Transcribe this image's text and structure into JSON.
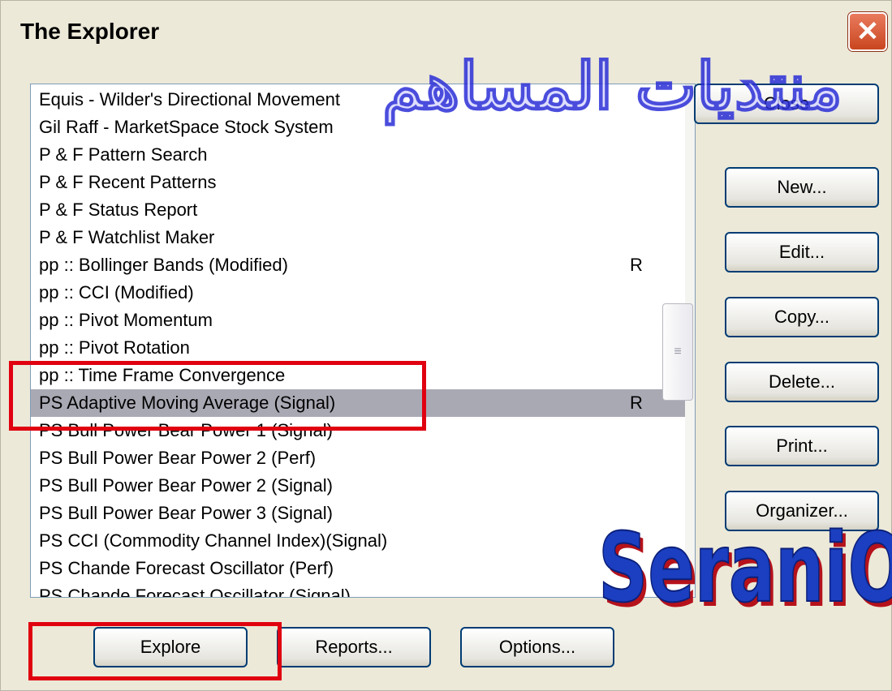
{
  "window": {
    "title": "The Explorer",
    "close_glyph": "✕"
  },
  "explorations": [
    {
      "name": "Equis - Wilder's Directional Movement",
      "flag": ""
    },
    {
      "name": "Gil Raff - MarketSpace Stock System",
      "flag": ""
    },
    {
      "name": "P & F Pattern Search",
      "flag": ""
    },
    {
      "name": "P & F Recent Patterns",
      "flag": ""
    },
    {
      "name": "P & F Status Report",
      "flag": ""
    },
    {
      "name": "P & F Watchlist Maker",
      "flag": ""
    },
    {
      "name": "pp :: Bollinger Bands (Modified)",
      "flag": "R"
    },
    {
      "name": "pp :: CCI (Modified)",
      "flag": ""
    },
    {
      "name": "pp :: Pivot Momentum",
      "flag": ""
    },
    {
      "name": "pp :: Pivot Rotation",
      "flag": ""
    },
    {
      "name": "pp :: Time Frame Convergence",
      "flag": ""
    },
    {
      "name": "PS Adaptive Moving Average (Signal)",
      "flag": "R",
      "selected": true
    },
    {
      "name": "PS Bull Power Bear Power 1 (Signal)",
      "flag": ""
    },
    {
      "name": "PS Bull Power Bear Power 2 (Perf)",
      "flag": ""
    },
    {
      "name": "PS Bull Power Bear Power 2 (Signal)",
      "flag": ""
    },
    {
      "name": "PS Bull Power Bear Power 3 (Signal)",
      "flag": ""
    },
    {
      "name": "PS CCI (Commodity Channel Index)(Signal)",
      "flag": ""
    },
    {
      "name": "PS Chande Forecast Oscillator (Perf)",
      "flag": ""
    },
    {
      "name": "PS Chande Forecast Oscillator (Signal)",
      "flag": ""
    }
  ],
  "side_buttons": {
    "close": "Close",
    "new": "New...",
    "edit": "Edit...",
    "copy": "Copy...",
    "delete": "Delete...",
    "print": "Print...",
    "organizer": "Organizer..."
  },
  "bottom_buttons": {
    "explore": "Explore",
    "reports": "Reports...",
    "options": "Options..."
  },
  "watermarks": {
    "arabic": "منتديات المساهم",
    "latin": "SeraniO"
  },
  "colors": {
    "callout": "#e00010",
    "selection": "#a9a9b4",
    "button_border": "#003c74"
  }
}
